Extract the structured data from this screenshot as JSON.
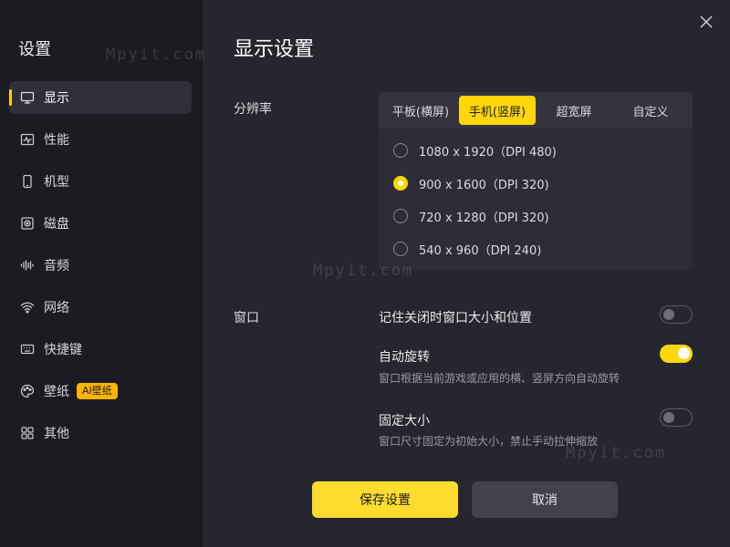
{
  "sidebar": {
    "title": "设置",
    "items": [
      {
        "label": "显示",
        "icon": "monitor-icon",
        "active": true
      },
      {
        "label": "性能",
        "icon": "performance-icon"
      },
      {
        "label": "机型",
        "icon": "phone-icon"
      },
      {
        "label": "磁盘",
        "icon": "disk-icon"
      },
      {
        "label": "音频",
        "icon": "audio-icon"
      },
      {
        "label": "网络",
        "icon": "wifi-icon"
      },
      {
        "label": "快捷键",
        "icon": "keyboard-icon"
      },
      {
        "label": "壁纸",
        "icon": "palette-icon",
        "badge": "AI壁纸"
      },
      {
        "label": "其他",
        "icon": "grid-icon"
      }
    ]
  },
  "main": {
    "title": "显示设置",
    "resolution": {
      "label": "分辨率",
      "tabs": [
        "平板(横屏)",
        "手机(竖屏)",
        "超宽屏",
        "自定义"
      ],
      "active_tab": 1,
      "options": [
        {
          "text": "1080 x 1920（DPI 480)",
          "checked": false
        },
        {
          "text": "900 x 1600（DPI 320)",
          "checked": true
        },
        {
          "text": "720 x 1280（DPI 320)",
          "checked": false
        },
        {
          "text": "540 x 960（DPI 240)",
          "checked": false
        }
      ]
    },
    "window": {
      "label": "窗口",
      "options": [
        {
          "title": "记住关闭时窗口大小和位置",
          "desc": "",
          "on": false
        },
        {
          "title": "自动旋转",
          "desc": "窗口根据当前游戏或应用的横、竖屏方向自动旋转",
          "on": true
        },
        {
          "title": "固定大小",
          "desc": "窗口尺寸固定为初始大小，禁止手动拉伸缩放",
          "on": false
        }
      ]
    },
    "buttons": {
      "save": "保存设置",
      "cancel": "取消"
    }
  },
  "watermark": "Mpyit.com",
  "colors": {
    "accent": "#ffd60a",
    "sidebar_bg": "#1b1c22",
    "main_bg": "#25262e"
  }
}
